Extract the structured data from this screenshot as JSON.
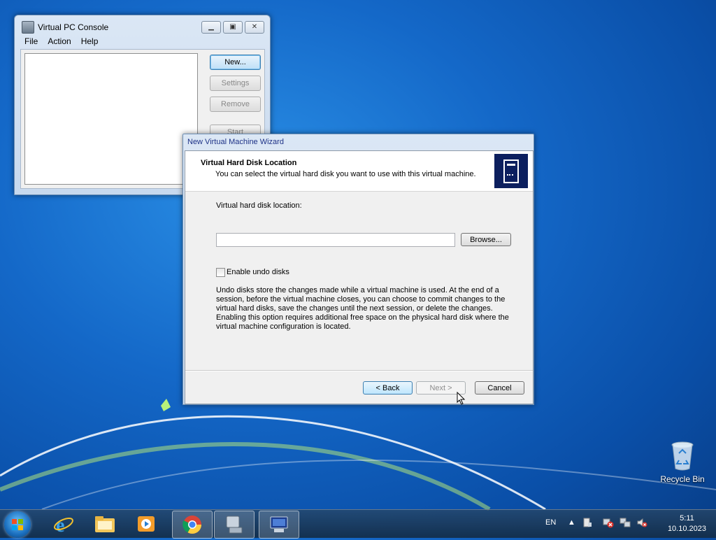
{
  "desktop": {
    "recycle_bin_label": "Recycle Bin"
  },
  "console": {
    "title": "Virtual PC Console",
    "menu": [
      "File",
      "Action",
      "Help"
    ],
    "buttons": {
      "new": "New...",
      "settings": "Settings",
      "remove": "Remove",
      "start": "Start"
    }
  },
  "wizard": {
    "window_title": "New Virtual Machine Wizard",
    "header_title": "Virtual Hard Disk Location",
    "header_subtitle": "You can select the virtual hard disk you want to use with this virtual machine.",
    "location_label": "Virtual hard disk location:",
    "location_value": "",
    "browse_label": "Browse...",
    "undo_label": "Enable undo disks",
    "undo_checked": false,
    "description": "Undo disks store the changes made while a virtual machine is used. At the end of a session, before the virtual machine closes, you can choose to commit changes to the virtual hard disks, save the changes until the next session, or delete the changes. Enabling this option requires additional free space on the physical hard disk where the virtual machine configuration is located.",
    "back_label": "< Back",
    "next_label": "Next >",
    "cancel_label": "Cancel"
  },
  "taskbar": {
    "apps": [
      "internet-explorer-icon",
      "file-explorer-icon",
      "media-player-icon",
      "chrome-icon",
      "virtual-pc-icon",
      "virtual-pc-wizard-icon"
    ],
    "language": "EN",
    "time": "5:11",
    "date": "10.10.2023"
  }
}
